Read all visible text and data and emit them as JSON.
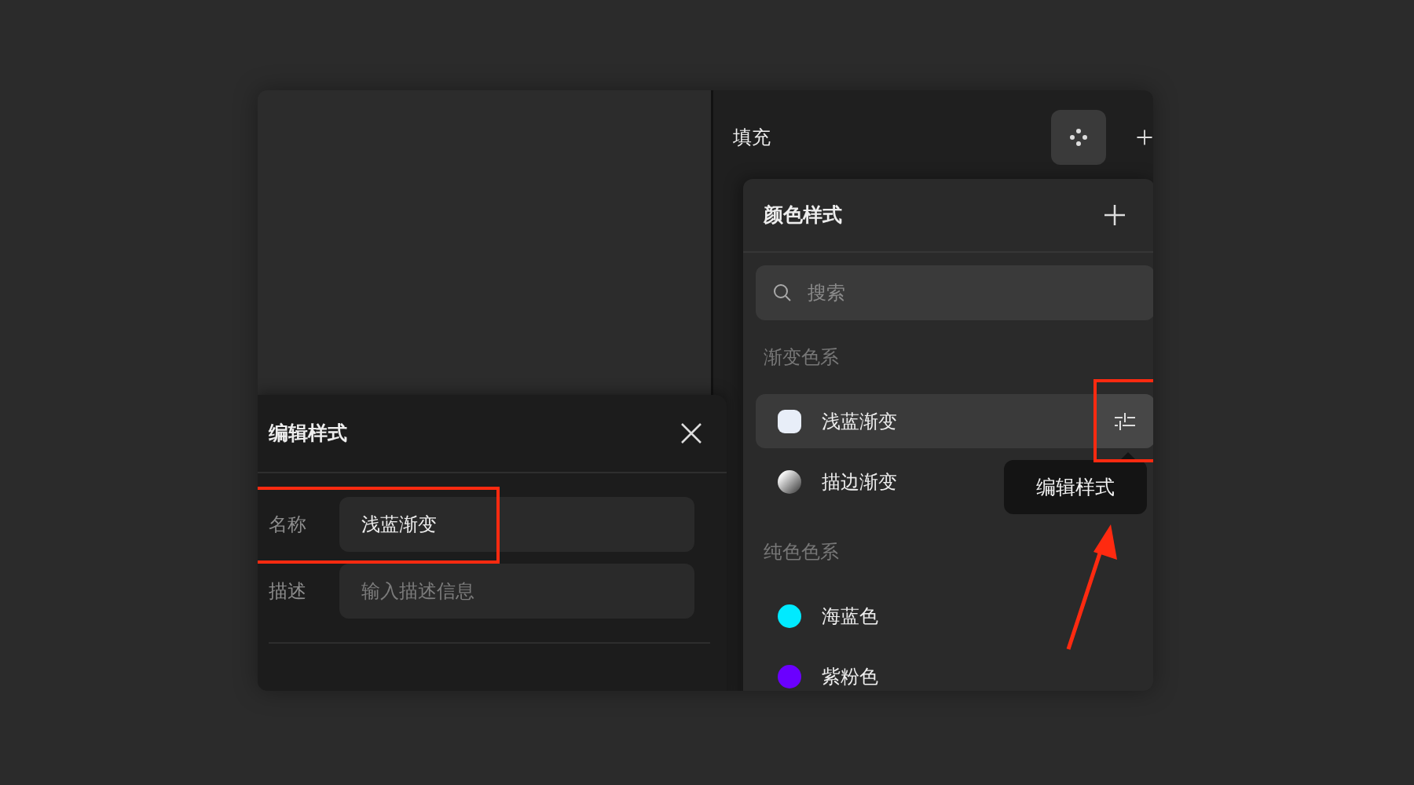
{
  "fill_panel": {
    "title": "填充"
  },
  "color_styles": {
    "title": "颜色样式",
    "search": {
      "placeholder": "搜索"
    },
    "groups": [
      {
        "title": "渐变色系",
        "items": [
          {
            "name": "浅蓝渐变",
            "kind": "light-gradient",
            "color": "#e8eef8",
            "selected": true
          },
          {
            "name": "描边渐变",
            "kind": "dark-gradient",
            "color": "#f2f2f2",
            "selected": false
          }
        ]
      },
      {
        "title": "纯色色系",
        "items": [
          {
            "name": "海蓝色",
            "kind": "solid",
            "color": "#00eaff",
            "selected": false
          },
          {
            "name": "紫粉色",
            "kind": "solid",
            "color": "#6b00ff",
            "selected": false
          }
        ]
      }
    ]
  },
  "tooltip": {
    "text": "编辑样式"
  },
  "edit_style": {
    "title": "编辑样式",
    "fields": [
      {
        "label": "名称",
        "value": "浅蓝渐变"
      },
      {
        "label": "描述",
        "placeholder": "输入描述信息"
      }
    ]
  }
}
